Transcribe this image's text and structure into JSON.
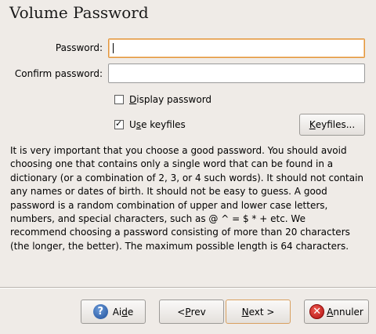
{
  "window": {
    "title": "Volume Password"
  },
  "form": {
    "password_label": "Password:",
    "password_value": "",
    "confirm_label": "Confirm password:",
    "confirm_value": "",
    "display_password": {
      "label_underlined": "D",
      "label_rest": "isplay password",
      "checked": false
    },
    "use_keyfiles": {
      "label_prefix": "U",
      "label_underlined": "s",
      "label_rest": "e keyfiles",
      "checked": true
    },
    "keyfiles_button": {
      "underlined": "K",
      "rest": "eyfiles..."
    }
  },
  "description": "It is very important that you choose a good password. You should avoid choosing one that contains only a single word that can be found in a dictionary (or a combination of 2, 3, or 4 such words). It should not contain any names or dates of birth. It should not be easy to guess. A good password is a random combination of upper and lower case letters, numbers, and special characters, such as @ ^ = $ * + etc. We recommend choosing a password consisting of more than 20 characters (the longer, the better). The maximum possible length is 64 characters.",
  "buttons": {
    "help": {
      "icon": "?",
      "prefix": "Ai",
      "underlined": "d",
      "rest": "e"
    },
    "prev": {
      "prefix": "< ",
      "underlined": "P",
      "rest": "rev"
    },
    "next": {
      "underlined": "N",
      "rest": "ext >"
    },
    "cancel": {
      "icon": "✕",
      "underlined": "A",
      "rest": "nnuler"
    }
  },
  "colors": {
    "background": "#efebe7",
    "focus_border": "#e3963b",
    "help_icon": "#2a5da8",
    "cancel_icon": "#c81818"
  }
}
